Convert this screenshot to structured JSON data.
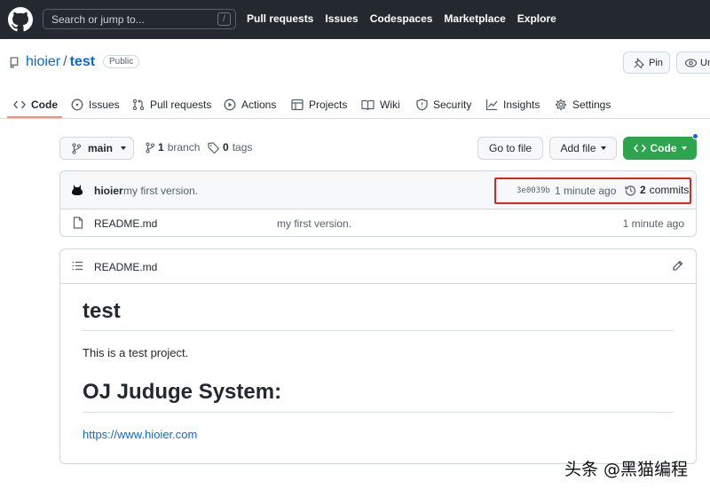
{
  "header": {
    "search_placeholder": "Search or jump to...",
    "search_shortcut": "/",
    "nav": [
      "Pull requests",
      "Issues",
      "Codespaces",
      "Marketplace",
      "Explore"
    ]
  },
  "repo": {
    "owner": "hioier",
    "separator": "/",
    "name": "test",
    "visibility": "Public",
    "pin_label": "Pin",
    "watch_label": "Unwatch"
  },
  "tabs": [
    {
      "label": "Code",
      "icon": "code-icon",
      "selected": true
    },
    {
      "label": "Issues",
      "icon": "issue-icon"
    },
    {
      "label": "Pull requests",
      "icon": "pull-request-icon"
    },
    {
      "label": "Actions",
      "icon": "play-icon"
    },
    {
      "label": "Projects",
      "icon": "table-icon"
    },
    {
      "label": "Wiki",
      "icon": "book-icon"
    },
    {
      "label": "Security",
      "icon": "shield-icon"
    },
    {
      "label": "Insights",
      "icon": "graph-icon"
    },
    {
      "label": "Settings",
      "icon": "gear-icon"
    }
  ],
  "controls": {
    "branch": "main",
    "branch_count": "1",
    "branch_word": "branch",
    "tag_count": "0",
    "tag_word": "tags",
    "go_to_file": "Go to file",
    "add_file": "Add file",
    "code": "Code"
  },
  "latest_commit": {
    "author": "hioier",
    "message": "my first version.",
    "sha": "3e0039b",
    "time": "1 minute ago",
    "commit_count": "2",
    "commit_word": "commits"
  },
  "files": [
    {
      "name": "README.md",
      "message": "my first version.",
      "age": "1 minute ago"
    }
  ],
  "readme": {
    "title": "README.md",
    "h1": "test",
    "paragraph": "This is a test project.",
    "h2": "OJ Juduge System:",
    "link": "https://www.hioier.com"
  },
  "watermark": "头条 @黑猫编程",
  "colors": {
    "header_bg": "#24292f",
    "link": "#0969da",
    "primary_button": "#2da44e",
    "tab_underline": "#fd8c73",
    "highlight_box": "#e0261b"
  }
}
